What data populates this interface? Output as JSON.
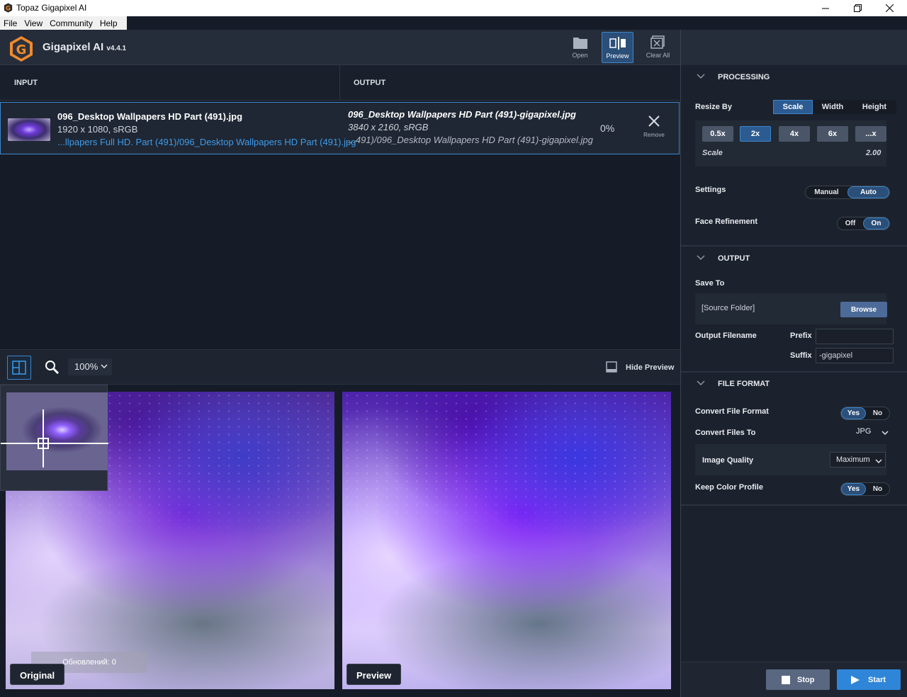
{
  "window": {
    "title": "Topaz Gigapixel AI"
  },
  "menu": [
    "File",
    "View",
    "Community",
    "Help"
  ],
  "app": {
    "name": "Gigapixel AI",
    "version": "v4.4.1"
  },
  "toolbar": {
    "open": "Open",
    "preview": "Preview",
    "clear_all": "Clear All"
  },
  "list": {
    "input_header": "INPUT",
    "output_header": "OUTPUT",
    "file": {
      "input_name": "096_Desktop Wallpapers  HD Part (491).jpg",
      "input_dims": "1920 x 1080, sRGB",
      "input_path": "...llpapers Full HD. Part (491)/096_Desktop Wallpapers  HD Part (491).jpg",
      "output_name": "096_Desktop Wallpapers  HD Part (491)-gigapixel.jpg",
      "output_dims": "3840 x 2160, sRGB",
      "output_path": "...491)/096_Desktop Wallpapers  HD Part (491)-gigapixel.jpg",
      "progress": "0%",
      "remove": "Remove"
    }
  },
  "preview_bar": {
    "zoom": "100%",
    "hide_preview": "Hide Preview"
  },
  "preview": {
    "original_label": "Original",
    "preview_label": "Preview",
    "updates_text": "Обновлений: 0"
  },
  "processing": {
    "title": "PROCESSING",
    "resize_by": "Resize By",
    "resize_tabs": [
      "Scale",
      "Width",
      "Height"
    ],
    "resize_selected": "Scale",
    "scale_options": [
      "0.5x",
      "2x",
      "4x",
      "6x",
      "...x"
    ],
    "scale_selected": "2x",
    "scale_label": "Scale",
    "scale_value": "2.00",
    "settings_label": "Settings",
    "settings_options": [
      "Manual",
      "Auto"
    ],
    "settings_selected": "Auto",
    "face_label": "Face Refinement",
    "face_options": [
      "Off",
      "On"
    ],
    "face_selected": "On"
  },
  "output": {
    "title": "OUTPUT",
    "save_to": "Save To",
    "save_value": "[Source Folder]",
    "browse": "Browse",
    "filename_label": "Output Filename",
    "prefix_label": "Prefix",
    "prefix_value": "",
    "suffix_label": "Suffix",
    "suffix_value": "-gigapixel"
  },
  "file_format": {
    "title": "FILE FORMAT",
    "convert_label": "Convert File Format",
    "convert_options": [
      "Yes",
      "No"
    ],
    "convert_selected": "Yes",
    "convert_to_label": "Convert Files To",
    "convert_to_value": "JPG",
    "quality_label": "Image Quality",
    "quality_value": "Maximum",
    "keep_label": "Keep Color Profile",
    "keep_options": [
      "Yes",
      "No"
    ],
    "keep_selected": "Yes"
  },
  "footer": {
    "stop": "Stop",
    "start": "Start"
  },
  "colors": {
    "accent": "#3d86c9",
    "panel": "#1c222d",
    "start": "#2f86d8",
    "browse": "#4d6b99"
  }
}
